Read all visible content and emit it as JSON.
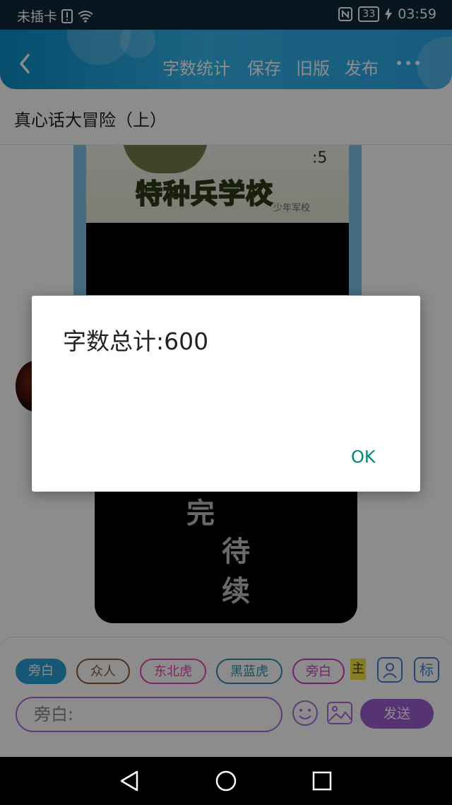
{
  "status_bar": {
    "carrier": "未插卡",
    "battery": "33",
    "time": "03:59"
  },
  "header": {
    "nav_items": [
      "字数统计",
      "保存",
      "旧版",
      "发布"
    ]
  },
  "title": "真心话大冒险（上）",
  "content": {
    "poster_title": "特种兵学校",
    "poster_watermark": "少年军校",
    "end_text_chars": [
      "完",
      "待",
      "续"
    ]
  },
  "bottom": {
    "chips": [
      "旁白",
      "众人",
      "东北虎",
      "黑蓝虎",
      "旁白"
    ],
    "zhu_label": "主",
    "tag_label": "标",
    "input_placeholder": "旁白:",
    "send_label": "发送"
  },
  "dialog": {
    "message": "字数总计:600",
    "ok_label": "OK"
  },
  "colors": {
    "header_blue": "#2aa7e6",
    "send_purple": "#9d5fd1",
    "ok_teal": "#00897b",
    "active_chip_blue": "#2a9fd8"
  }
}
